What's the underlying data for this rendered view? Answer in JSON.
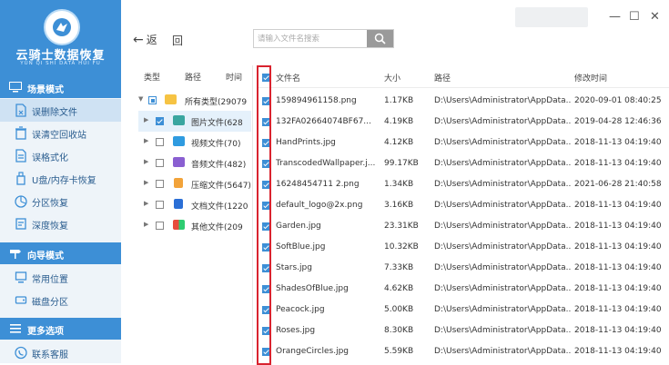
{
  "app": {
    "title": "云骑士数据恢复",
    "subtitle": "YUN QI SHI DATA HUI FU"
  },
  "colors": {
    "accent": "#3d8fd6",
    "highlight": "#d9232f",
    "sidebar_bg": "#eef4f9"
  },
  "sidebar": {
    "sections": [
      {
        "title": "场景模式",
        "icon": "monitor-icon",
        "items": [
          {
            "label": "误删除文件",
            "icon": "file-delete-icon",
            "active": true
          },
          {
            "label": "误清空回收站",
            "icon": "recycle-bin-icon",
            "active": false
          },
          {
            "label": "误格式化",
            "icon": "format-icon",
            "active": false
          },
          {
            "label": "U盘/内存卡恢复",
            "icon": "usb-icon",
            "active": false
          },
          {
            "label": "分区恢复",
            "icon": "partition-icon",
            "active": false
          },
          {
            "label": "深度恢复",
            "icon": "deep-scan-icon",
            "active": false
          }
        ]
      },
      {
        "title": "向导模式",
        "icon": "signpost-icon",
        "items": [
          {
            "label": "常用位置",
            "icon": "location-icon",
            "active": false
          },
          {
            "label": "磁盘分区",
            "icon": "disk-icon",
            "active": false
          }
        ]
      },
      {
        "title": "更多选项",
        "icon": "menu-icon",
        "items": [
          {
            "label": "联系客服",
            "icon": "phone-icon",
            "active": false
          }
        ]
      }
    ]
  },
  "toolbar": {
    "back_label": "返",
    "refresh_label": "回",
    "search_placeholder": "请输入文件名搜索",
    "minimize": "—",
    "maximize": "☐",
    "close": "✕"
  },
  "tree": {
    "headers": [
      "类型",
      "路径",
      "时间"
    ],
    "rows": [
      {
        "label": "所有类型(29079",
        "icon": "folder-icon",
        "check": "partial",
        "expand": "▼",
        "selected": false
      },
      {
        "label": "图片文件(628",
        "icon": "image-icon",
        "check": "on",
        "expand": "▶",
        "selected": true
      },
      {
        "label": "视频文件(70)",
        "icon": "video-icon",
        "check": "off",
        "expand": "▶",
        "selected": false
      },
      {
        "label": "音频文件(482)",
        "icon": "audio-icon",
        "check": "off",
        "expand": "▶",
        "selected": false
      },
      {
        "label": "压缩文件(5647)",
        "icon": "archive-icon",
        "check": "off",
        "expand": "▶",
        "selected": false
      },
      {
        "label": "文档文件(1220",
        "icon": "document-icon",
        "check": "off",
        "expand": "▶",
        "selected": false
      },
      {
        "label": "其他文件(209",
        "icon": "other-files-icon",
        "check": "off",
        "expand": "▶",
        "selected": false
      }
    ]
  },
  "file_table": {
    "columns": [
      "文件名",
      "大小",
      "路径",
      "修改时间"
    ],
    "rows": [
      {
        "name": "159894961158.png",
        "size": "1.17KB",
        "path": "D:\\Users\\Administrator\\AppData...",
        "modified": "2020-09-01 08:40:25"
      },
      {
        "name": "132FA02664074BF67...",
        "size": "4.19KB",
        "path": "D:\\Users\\Administrator\\AppData...",
        "modified": "2019-04-28 12:46:36"
      },
      {
        "name": "HandPrints.jpg",
        "size": "4.12KB",
        "path": "D:\\Users\\Administrator\\AppData...",
        "modified": "2018-11-13 04:19:40"
      },
      {
        "name": "TranscodedWallpaper.j...",
        "size": "99.17KB",
        "path": "D:\\Users\\Administrator\\AppData...",
        "modified": "2018-11-13 04:19:40"
      },
      {
        "name": "16248454711 2.png",
        "size": "1.34KB",
        "path": "D:\\Users\\Administrator\\AppData...",
        "modified": "2021-06-28 21:40:58"
      },
      {
        "name": "default_logo@2x.png",
        "size": "3.16KB",
        "path": "D:\\Users\\Administrator\\AppData...",
        "modified": "2018-11-13 04:19:40"
      },
      {
        "name": "Garden.jpg",
        "size": "23.31KB",
        "path": "D:\\Users\\Administrator\\AppData...",
        "modified": "2018-11-13 04:19:40"
      },
      {
        "name": "SoftBlue.jpg",
        "size": "10.32KB",
        "path": "D:\\Users\\Administrator\\AppData...",
        "modified": "2018-11-13 04:19:40"
      },
      {
        "name": "Stars.jpg",
        "size": "7.33KB",
        "path": "D:\\Users\\Administrator\\AppData...",
        "modified": "2018-11-13 04:19:40"
      },
      {
        "name": "ShadesOfBlue.jpg",
        "size": "4.62KB",
        "path": "D:\\Users\\Administrator\\AppData...",
        "modified": "2018-11-13 04:19:40"
      },
      {
        "name": "Peacock.jpg",
        "size": "5.00KB",
        "path": "D:\\Users\\Administrator\\AppData...",
        "modified": "2018-11-13 04:19:40"
      },
      {
        "name": "Roses.jpg",
        "size": "8.30KB",
        "path": "D:\\Users\\Administrator\\AppData...",
        "modified": "2018-11-13 04:19:40"
      },
      {
        "name": "OrangeCircles.jpg",
        "size": "5.59KB",
        "path": "D:\\Users\\Administrator\\AppData...",
        "modified": "2018-11-13 04:19:40"
      }
    ]
  }
}
